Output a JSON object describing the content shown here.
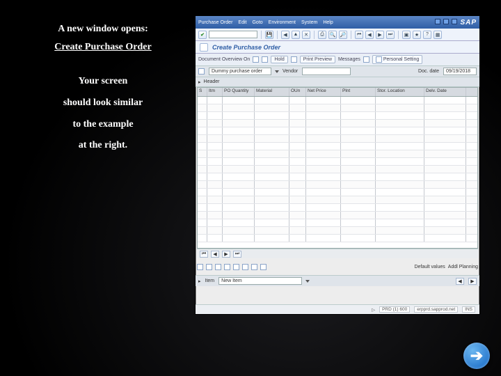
{
  "side": {
    "lead": "A new window opens:",
    "title": "Create Purchase Order",
    "body1": "Your screen",
    "body2": "should look similar",
    "body3": "to the example",
    "body4": "at the right."
  },
  "sap": {
    "menus": [
      "Purchase Order",
      "Edit",
      "Goto",
      "Environment",
      "System",
      "Help"
    ],
    "brand": "SAP",
    "txn_title": "Create Purchase Order",
    "sub": {
      "overview": "Document Overview On",
      "hold": "Hold",
      "preview": "Print Preview",
      "messages": "Messages",
      "personal": "Personal Setting"
    },
    "doc": {
      "type": "Dummy purchase order",
      "vendor_label": "Vendor",
      "vendor_value": "",
      "docdate_label": "Doc. date",
      "docdate_value": "09/19/2018"
    },
    "header_label": "Header",
    "grid": {
      "cols": [
        "S",
        "Itm",
        "PO Quantity",
        "Material",
        "OUn",
        "Net Price",
        "Plnt",
        "Stor. Location",
        "Delv. Date"
      ]
    },
    "actions": {
      "defaults": "Default values",
      "planning": "Addl Planning"
    },
    "item": {
      "label": "Item",
      "value": "New Item"
    },
    "status": {
      "client": "PRD (1) 600",
      "host": "erpprd.sapprod.net",
      "ins": "INS"
    }
  },
  "next_glyph": "➔"
}
